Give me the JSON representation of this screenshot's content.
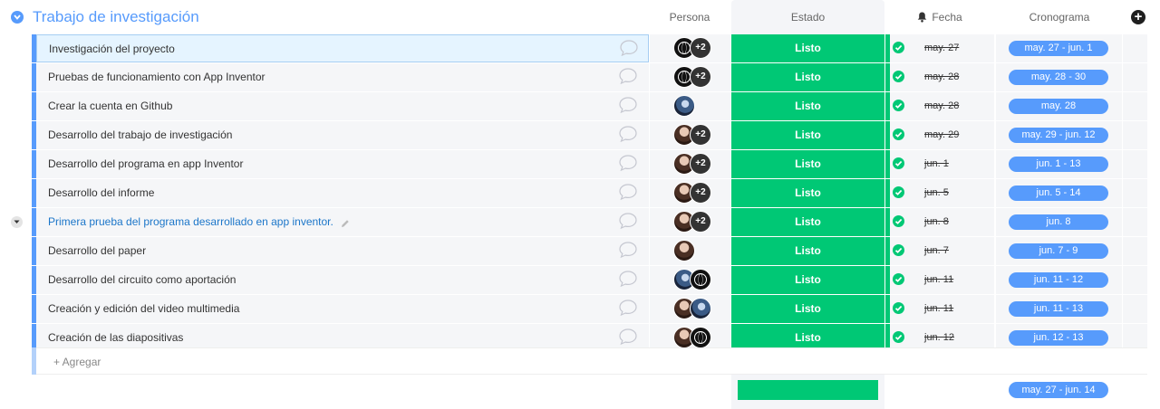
{
  "group": {
    "title": "Trabajo de investigación"
  },
  "columns": {
    "persona": "Persona",
    "estado": "Estado",
    "fecha": "Fecha",
    "cronograma": "Cronograma",
    "add_symbol": "+"
  },
  "rows": [
    {
      "name": "Investigación del proyecto",
      "avatars": [
        "logo",
        "+2"
      ],
      "estado": "Listo",
      "fecha": "may. 27",
      "crono": "may. 27 - jun. 1"
    },
    {
      "name": "Pruebas de funcionamiento con App Inventor",
      "avatars": [
        "logo",
        "+2"
      ],
      "estado": "Listo",
      "fecha": "may. 28",
      "crono": "may. 28 - 30"
    },
    {
      "name": "Crear la cuenta en Github",
      "avatars": [
        "photo-b"
      ],
      "estado": "Listo",
      "fecha": "may. 28",
      "crono": "may. 28"
    },
    {
      "name": "Desarrollo del trabajo de investigación",
      "avatars": [
        "photo-a",
        "+2"
      ],
      "estado": "Listo",
      "fecha": "may. 29",
      "crono": "may. 29 - jun. 12"
    },
    {
      "name": "Desarrollo del programa en app Inventor",
      "avatars": [
        "photo-a",
        "+2"
      ],
      "estado": "Listo",
      "fecha": "jun. 1",
      "crono": "jun. 1 - 13"
    },
    {
      "name": "Desarrollo del informe",
      "avatars": [
        "photo-a",
        "+2"
      ],
      "estado": "Listo",
      "fecha": "jun. 5",
      "crono": "jun. 5 - 14"
    },
    {
      "name": "Primera prueba del programa desarrollado en app inventor.",
      "avatars": [
        "photo-a",
        "+2"
      ],
      "estado": "Listo",
      "fecha": "jun. 8",
      "crono": "jun. 8"
    },
    {
      "name": "Desarrollo del paper",
      "avatars": [
        "photo-a"
      ],
      "estado": "Listo",
      "fecha": "jun. 7",
      "crono": "jun. 7 - 9"
    },
    {
      "name": "Desarrollo del circuito como aportación",
      "avatars": [
        "photo-b",
        "logo"
      ],
      "estado": "Listo",
      "fecha": "jun. 11",
      "crono": "jun. 11 - 12"
    },
    {
      "name": "Creación y edición del video multimedia",
      "avatars": [
        "photo-a",
        "photo-b"
      ],
      "estado": "Listo",
      "fecha": "jun. 11",
      "crono": "jun. 11 - 13"
    },
    {
      "name": "Creación de las diapositivas",
      "avatars": [
        "photo-a",
        "logo"
      ],
      "estado": "Listo",
      "fecha": "jun. 12",
      "crono": "jun. 12 - 13"
    }
  ],
  "add_row": {
    "label": "+ Agregar"
  },
  "summary": {
    "crono": "may. 27 - jun. 14"
  },
  "colors": {
    "accent": "#579bfc",
    "done": "#00c875"
  },
  "icons": {
    "group_toggle": "chevron-down-icon",
    "bell": "bell-icon",
    "comment": "comment-bubble-icon",
    "check": "check-circle-icon",
    "pencil": "pencil-icon"
  }
}
